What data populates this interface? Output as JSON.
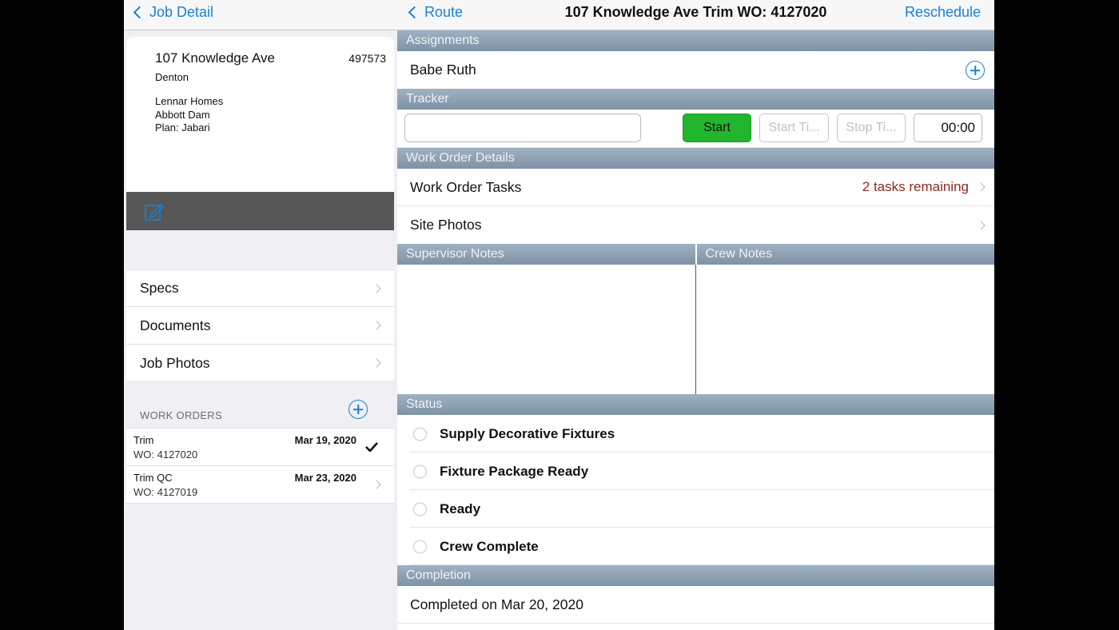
{
  "left": {
    "back_label": "Job Detail",
    "job": {
      "address": "107 Knowledge Ave",
      "job_number": "497573",
      "city": "Denton",
      "builder": "Lennar Homes",
      "community": "Abbott Dam",
      "plan": "Plan: Jabari"
    },
    "menu": [
      {
        "label": "Specs"
      },
      {
        "label": "Documents"
      },
      {
        "label": "Job Photos"
      }
    ],
    "work_orders_header": "WORK ORDERS",
    "work_orders": [
      {
        "name": "Trim",
        "wo": "WO: 4127020",
        "date": "Mar 19, 2020",
        "selected": true
      },
      {
        "name": "Trim QC",
        "wo": "WO: 4127019",
        "date": "Mar 23, 2020",
        "selected": false
      }
    ]
  },
  "right": {
    "back_label": "Route",
    "title": "107 Knowledge Ave Trim WO: 4127020",
    "reschedule_label": "Reschedule",
    "sections": {
      "assignments": "Assignments",
      "tracker": "Tracker",
      "work_order_details": "Work Order Details",
      "supervisor_notes": "Supervisor Notes",
      "crew_notes": "Crew Notes",
      "status": "Status",
      "completion": "Completion"
    },
    "assignee": "Babe Ruth",
    "tracker": {
      "input_value": "",
      "start_label": "Start",
      "start_time_label": "Start Ti...",
      "stop_time_label": "Stop Ti...",
      "elapsed": "00:00"
    },
    "details": {
      "tasks_label": "Work Order Tasks",
      "tasks_remaining": "2 tasks remaining",
      "site_photos_label": "Site Photos"
    },
    "status_items": [
      {
        "label": "Supply Decorative Fixtures"
      },
      {
        "label": "Fixture Package Ready"
      },
      {
        "label": "Ready"
      },
      {
        "label": "Crew Complete"
      }
    ],
    "completion_text": "Completed on Mar 20, 2020"
  },
  "colors": {
    "accent": "#1a7fd6",
    "start_green": "#22b52e",
    "remaining_red": "#8e2a1f",
    "section_header": "#8fa2b4"
  }
}
